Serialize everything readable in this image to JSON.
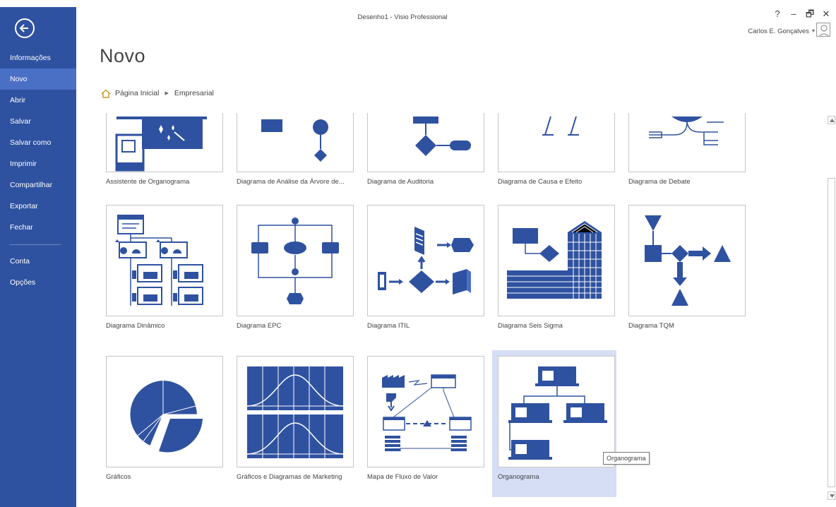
{
  "window": {
    "title": "Desenho1 - Visio Professional",
    "help": "?",
    "minimize": "–",
    "restore": "🗗",
    "close": "✕",
    "user_name": "Carlos E. Gonçalves",
    "user_caret": "▾"
  },
  "sidebar": {
    "items": [
      {
        "label": "Informações"
      },
      {
        "label": "Novo"
      },
      {
        "label": "Abrir"
      },
      {
        "label": "Salvar"
      },
      {
        "label": "Salvar como"
      },
      {
        "label": "Imprimir"
      },
      {
        "label": "Compartilhar"
      },
      {
        "label": "Exportar"
      },
      {
        "label": "Fechar"
      },
      {
        "label": "Conta"
      },
      {
        "label": "Opções"
      }
    ],
    "active": "Novo"
  },
  "page": {
    "title": "Novo",
    "breadcrumb": [
      "Página Inicial",
      "Empresarial"
    ],
    "breadcrumb_sep": "▶"
  },
  "templates": [
    {
      "label": "Assistente de Organograma",
      "icon": "org-chart-wizard-icon"
    },
    {
      "label": "Diagrama de Análise da Árvore de...",
      "icon": "fault-tree-icon"
    },
    {
      "label": "Diagrama de Auditoria",
      "icon": "audit-diagram-icon"
    },
    {
      "label": "Diagrama de Causa e Efeito",
      "icon": "cause-effect-icon"
    },
    {
      "label": "Diagrama de Debate",
      "icon": "brainstorming-icon"
    },
    {
      "label": "Diagrama Dinâmico",
      "icon": "pivot-diagram-icon"
    },
    {
      "label": "Diagrama EPC",
      "icon": "epc-diagram-icon"
    },
    {
      "label": "Diagrama ITIL",
      "icon": "itil-diagram-icon"
    },
    {
      "label": "Diagrama Seis Sigma",
      "icon": "six-sigma-icon"
    },
    {
      "label": "Diagrama TQM",
      "icon": "tqm-diagram-icon"
    },
    {
      "label": "Gráficos",
      "icon": "pie-chart-icon"
    },
    {
      "label": "Gráficos e Diagramas de Marketing",
      "icon": "marketing-charts-icon"
    },
    {
      "label": "Mapa de Fluxo de Valor",
      "icon": "value-stream-map-icon"
    },
    {
      "label": "Organograma",
      "icon": "org-chart-icon"
    }
  ],
  "selected_template": "Organograma",
  "tooltip": "Organograma",
  "colors": {
    "sidebar": "#2f52a0",
    "sidebar_active": "#4a70c6",
    "shape_blue": "#2f52a0",
    "selection": "#d5def5"
  }
}
